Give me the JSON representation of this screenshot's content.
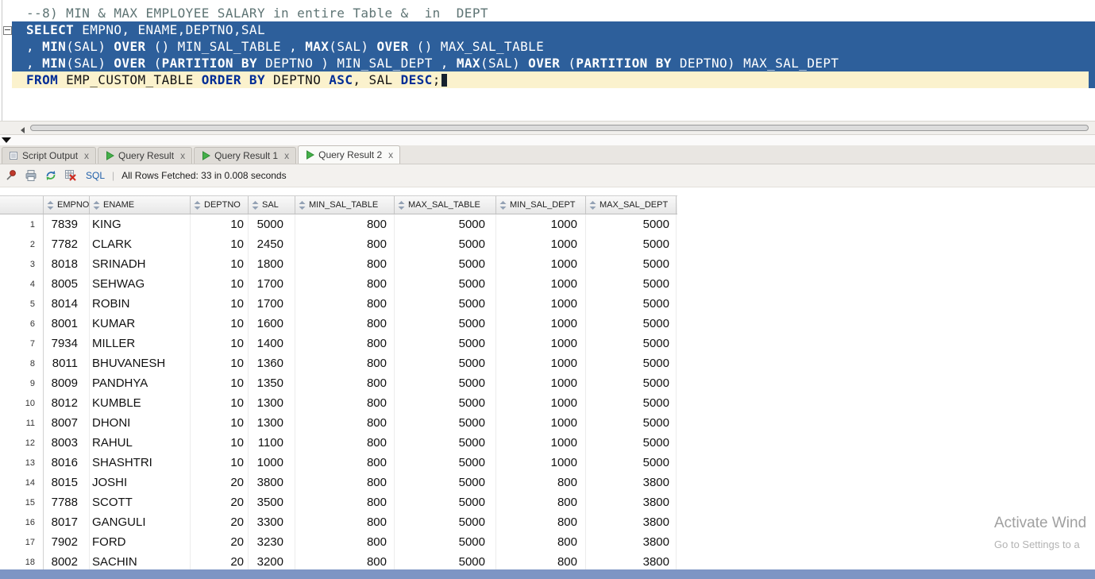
{
  "colors": {
    "selection_bg": "#2d5f9b",
    "current_line_bg": "#fbf2cd",
    "keyword_navy": "#002d96",
    "comment_gray": "#5e7474",
    "taskbar_blue": "#7d95c4",
    "play_green": "#44b049"
  },
  "editor": {
    "comment": "--8) MIN & MAX EMPLOYEE SALARY in entire Table &  in  DEPT",
    "lines": [
      {
        "cls": "sel",
        "segments": [
          {
            "t": "SELECT",
            "k": 1
          },
          {
            "t": " EMPNO, ENAME,DEPTNO,SAL"
          }
        ]
      },
      {
        "cls": "sel",
        "segments": [
          {
            "t": ", "
          },
          {
            "t": "MIN",
            "k": 1
          },
          {
            "t": "(SAL) "
          },
          {
            "t": "OVER",
            "k": 1
          },
          {
            "t": " () MIN_SAL_TABLE , "
          },
          {
            "t": "MAX",
            "k": 1
          },
          {
            "t": "(SAL) "
          },
          {
            "t": "OVER",
            "k": 1
          },
          {
            "t": " () MAX_SAL_TABLE"
          }
        ]
      },
      {
        "cls": "sel",
        "segments": [
          {
            "t": ", "
          },
          {
            "t": "MIN",
            "k": 1
          },
          {
            "t": "(SAL) "
          },
          {
            "t": "OVER",
            "k": 1
          },
          {
            "t": " ("
          },
          {
            "t": "PARTITION BY",
            "k": 1
          },
          {
            "t": " DEPTNO ) MIN_SAL_DEPT , "
          },
          {
            "t": "MAX",
            "k": 1
          },
          {
            "t": "(SAL) "
          },
          {
            "t": "OVER",
            "k": 1
          },
          {
            "t": " ("
          },
          {
            "t": "PARTITION BY",
            "k": 1
          },
          {
            "t": " DEPTNO) MAX_SAL_DEPT"
          }
        ]
      },
      {
        "cls": "cur",
        "cursor": true,
        "segments": [
          {
            "t": "FROM",
            "k": 1
          },
          {
            "t": " EMP_CUSTOM_TABLE "
          },
          {
            "t": "ORDER BY",
            "k": 1
          },
          {
            "t": " DEPTNO "
          },
          {
            "t": "ASC",
            "k": 1
          },
          {
            "t": ", SAL "
          },
          {
            "t": "DESC",
            "k": 1
          },
          {
            "t": ";"
          }
        ]
      }
    ]
  },
  "tabs": [
    {
      "label": "Script Output",
      "icon": "script",
      "active": false
    },
    {
      "label": "Query Result",
      "icon": "play",
      "active": false
    },
    {
      "label": "Query Result 1",
      "icon": "play",
      "active": false
    },
    {
      "label": "Query Result 2",
      "icon": "play",
      "active": true
    }
  ],
  "ui": {
    "tab_close": "x"
  },
  "toolbar": {
    "sql_label": "SQL",
    "separator": "|",
    "status": "All Rows Fetched: 33 in 0.008 seconds",
    "icons": [
      "freeze-view-pin-icon",
      "printer-icon",
      "refresh-icon",
      "delete-grid-icon"
    ]
  },
  "grid": {
    "columns": [
      "EMPNO",
      "ENAME",
      "DEPTNO",
      "SAL",
      "MIN_SAL_TABLE",
      "MAX_SAL_TABLE",
      "MIN_SAL_DEPT",
      "MAX_SAL_DEPT"
    ],
    "rows": [
      [
        "1",
        "7839",
        "KING",
        "10",
        "5000",
        "800",
        "5000",
        "1000",
        "5000"
      ],
      [
        "2",
        "7782",
        "CLARK",
        "10",
        "2450",
        "800",
        "5000",
        "1000",
        "5000"
      ],
      [
        "3",
        "8018",
        "SRINADH",
        "10",
        "1800",
        "800",
        "5000",
        "1000",
        "5000"
      ],
      [
        "4",
        "8005",
        "SEHWAG",
        "10",
        "1700",
        "800",
        "5000",
        "1000",
        "5000"
      ],
      [
        "5",
        "8014",
        "ROBIN",
        "10",
        "1700",
        "800",
        "5000",
        "1000",
        "5000"
      ],
      [
        "6",
        "8001",
        "KUMAR",
        "10",
        "1600",
        "800",
        "5000",
        "1000",
        "5000"
      ],
      [
        "7",
        "7934",
        "MILLER",
        "10",
        "1400",
        "800",
        "5000",
        "1000",
        "5000"
      ],
      [
        "8",
        "8011",
        "BHUVANESH",
        "10",
        "1360",
        "800",
        "5000",
        "1000",
        "5000"
      ],
      [
        "9",
        "8009",
        "PANDHYA",
        "10",
        "1350",
        "800",
        "5000",
        "1000",
        "5000"
      ],
      [
        "10",
        "8012",
        "KUMBLE",
        "10",
        "1300",
        "800",
        "5000",
        "1000",
        "5000"
      ],
      [
        "11",
        "8007",
        "DHONI",
        "10",
        "1300",
        "800",
        "5000",
        "1000",
        "5000"
      ],
      [
        "12",
        "8003",
        "RAHUL",
        "10",
        "1100",
        "800",
        "5000",
        "1000",
        "5000"
      ],
      [
        "13",
        "8016",
        "SHASHTRI",
        "10",
        "1000",
        "800",
        "5000",
        "1000",
        "5000"
      ],
      [
        "14",
        "8015",
        "JOSHI",
        "20",
        "3800",
        "800",
        "5000",
        "800",
        "3800"
      ],
      [
        "15",
        "7788",
        "SCOTT",
        "20",
        "3500",
        "800",
        "5000",
        "800",
        "3800"
      ],
      [
        "16",
        "8017",
        "GANGULI",
        "20",
        "3300",
        "800",
        "5000",
        "800",
        "3800"
      ],
      [
        "17",
        "7902",
        "FORD",
        "20",
        "3230",
        "800",
        "5000",
        "800",
        "3800"
      ],
      [
        "18",
        "8002",
        "SACHIN",
        "20",
        "3200",
        "800",
        "5000",
        "800",
        "3800"
      ]
    ]
  },
  "watermark": {
    "line1": "Activate Wind",
    "line2": "Go to Settings to a"
  }
}
